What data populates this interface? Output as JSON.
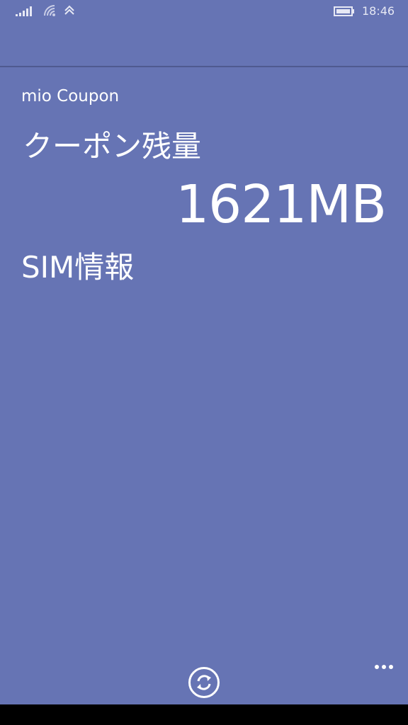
{
  "status_bar": {
    "time": "18:46",
    "icons": [
      "signal-icon",
      "wifi-icon",
      "data-connection-icon",
      "battery-icon"
    ]
  },
  "app": {
    "title": "mio Coupon"
  },
  "coupon": {
    "label": "クーポン残量",
    "remaining": "1621MB"
  },
  "sim": {
    "label": "SIM情報"
  },
  "app_bar": {
    "buttons": [
      "refresh-icon",
      "more-icon"
    ]
  },
  "colors": {
    "background": "#6674b4",
    "text": "#ffffff",
    "divider": "#4f5a8f"
  }
}
